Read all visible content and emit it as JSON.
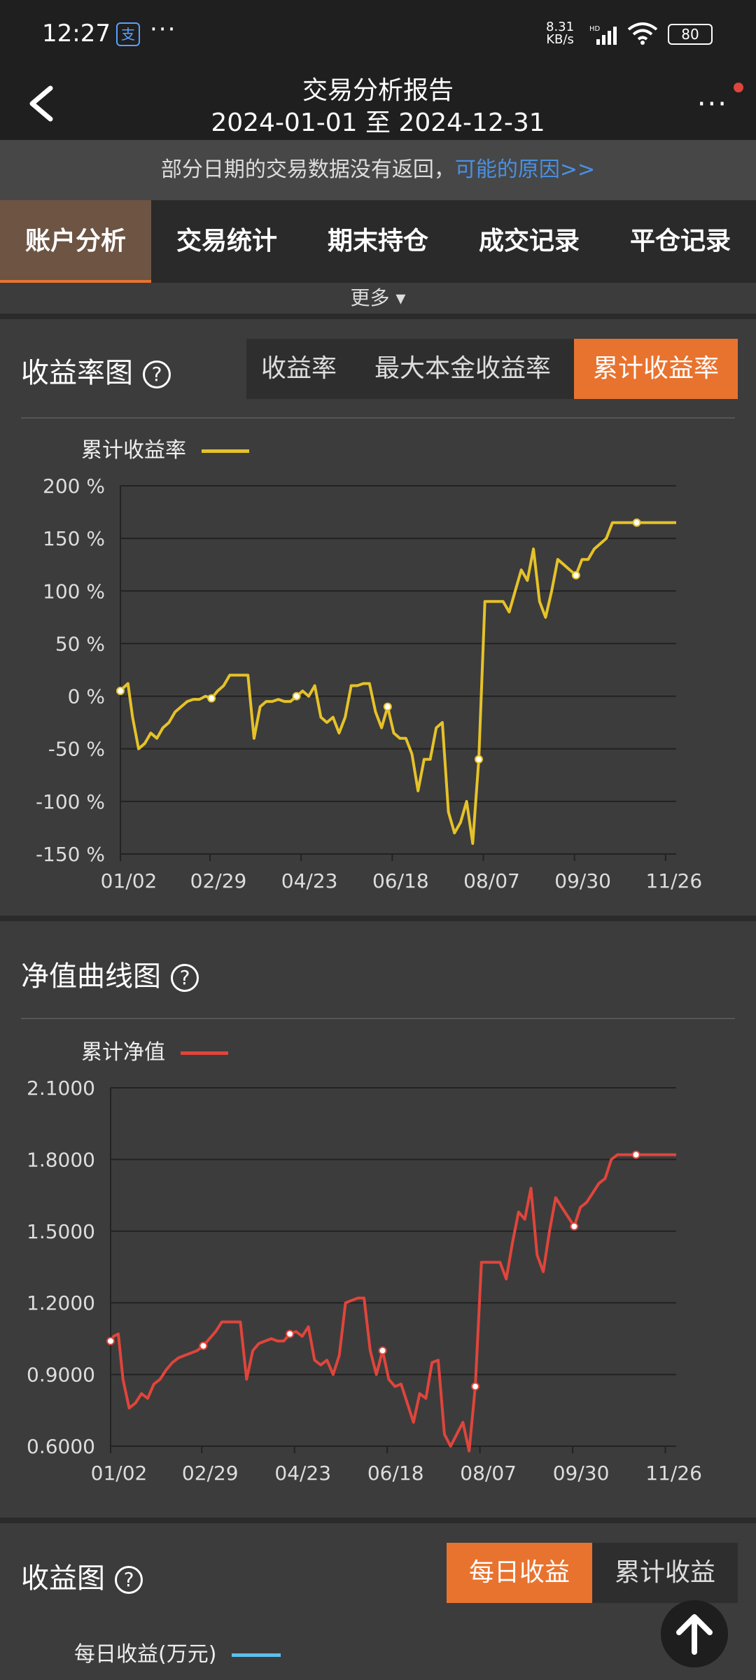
{
  "status": {
    "time": "12:27",
    "app_badge": "支",
    "dots": "···",
    "net_speed": "8.31",
    "net_unit": "KB/s",
    "hd": "HD",
    "battery": "80"
  },
  "header": {
    "title": "交易分析报告",
    "date_range": "2024-01-01 至 2024-12-31",
    "more": "···"
  },
  "notice": {
    "text": "部分日期的交易数据没有返回，",
    "link": "可能的原因>>"
  },
  "tabs": [
    "账户分析",
    "交易统计",
    "期末持仓",
    "成交记录",
    "平仓记录"
  ],
  "more_row": "更多 ▾",
  "return_section": {
    "title": "收益率图",
    "help": "?",
    "segments": [
      "收益率",
      "最大本金收益率",
      "累计收益率"
    ],
    "active_segment": 2
  },
  "nav_section": {
    "title": "净值曲线图",
    "help": "?"
  },
  "profit_section": {
    "title": "收益图",
    "help": "?",
    "segments": [
      "每日收益",
      "累计收益"
    ],
    "active_segment": 0,
    "legend": "每日收益(万元)",
    "legend_color": "#5bc0eb"
  },
  "colors": {
    "accent": "#e8732f",
    "yellow": "#e6c229",
    "red": "#e0453b",
    "link": "#4a90e2"
  },
  "chart_data": [
    {
      "type": "line",
      "legend": "累计收益率",
      "series": [
        {
          "name": "累计收益率",
          "color": "#e6c229",
          "x": [
            0,
            2,
            5,
            8,
            12,
            16,
            20,
            24,
            28,
            32,
            36,
            40,
            44,
            48,
            52,
            56,
            60,
            64,
            68,
            72,
            76,
            80,
            84,
            88,
            92,
            96,
            100,
            104,
            108,
            112,
            116,
            120,
            124,
            128,
            132,
            136,
            140,
            144,
            148,
            152,
            156,
            160,
            164,
            168,
            172,
            176,
            180,
            184,
            188,
            192,
            196,
            200,
            204,
            208,
            212,
            216,
            220,
            224,
            228,
            232,
            236,
            240,
            244,
            248,
            252,
            256,
            260,
            264,
            268,
            272,
            276,
            280,
            284,
            288,
            292,
            296,
            300,
            304,
            308,
            312,
            316,
            320,
            324,
            328,
            332,
            336,
            340,
            344,
            348,
            352,
            356,
            360,
            362,
            366
          ],
          "y": [
            5,
            8,
            12,
            -20,
            -50,
            -45,
            -35,
            -40,
            -30,
            -25,
            -15,
            -10,
            -5,
            -3,
            -3,
            0,
            -2,
            5,
            10,
            20,
            20,
            20,
            20,
            -40,
            -10,
            -5,
            -5,
            -3,
            -5,
            -5,
            0,
            5,
            0,
            10,
            -20,
            -25,
            -20,
            -35,
            -20,
            10,
            10,
            12,
            12,
            -15,
            -30,
            -10,
            -35,
            -40,
            -40,
            -55,
            -90,
            -60,
            -60,
            -30,
            -25,
            -110,
            -130,
            -120,
            -100,
            -140,
            -60,
            90,
            90,
            90,
            90,
            80,
            100,
            120,
            110,
            140,
            90,
            75,
            100,
            130,
            125,
            120,
            115,
            130,
            130,
            140,
            145,
            150,
            165,
            165,
            165,
            165,
            165,
            165,
            165,
            165,
            165,
            165,
            165,
            165
          ]
        }
      ],
      "ylim": [
        -150,
        200
      ],
      "yticks": [
        "200 %",
        "150 %",
        "100 %",
        "50 %",
        "0 %",
        "-50 %",
        "-100 %",
        "-150 %"
      ],
      "xticks": [
        "01/02",
        "02/29",
        "04/23",
        "06/18",
        "08/07",
        "09/30",
        "11/26"
      ],
      "grid": true
    },
    {
      "type": "line",
      "legend": "累计净值",
      "series": [
        {
          "name": "累计净值",
          "color": "#e0453b",
          "x": [
            0,
            2,
            5,
            8,
            12,
            16,
            20,
            24,
            28,
            32,
            36,
            40,
            44,
            48,
            52,
            56,
            60,
            64,
            68,
            72,
            76,
            80,
            84,
            88,
            92,
            96,
            100,
            104,
            108,
            112,
            116,
            120,
            124,
            128,
            132,
            136,
            140,
            144,
            148,
            152,
            156,
            160,
            164,
            168,
            172,
            176,
            180,
            184,
            188,
            192,
            196,
            200,
            204,
            208,
            212,
            216,
            220,
            224,
            228,
            232,
            236,
            240,
            244,
            248,
            252,
            256,
            260,
            264,
            268,
            272,
            276,
            280,
            284,
            288,
            292,
            296,
            300,
            304,
            308,
            312,
            316,
            320,
            324,
            328,
            332,
            336,
            340,
            344,
            348,
            352,
            356,
            360,
            362,
            366
          ],
          "y": [
            1.04,
            1.06,
            1.07,
            0.88,
            0.76,
            0.78,
            0.82,
            0.8,
            0.86,
            0.88,
            0.92,
            0.95,
            0.97,
            0.98,
            0.99,
            1.0,
            1.02,
            1.05,
            1.08,
            1.12,
            1.12,
            1.12,
            1.12,
            0.88,
            1.0,
            1.03,
            1.04,
            1.05,
            1.04,
            1.04,
            1.07,
            1.08,
            1.06,
            1.1,
            0.96,
            0.94,
            0.96,
            0.9,
            0.98,
            1.2,
            1.21,
            1.22,
            1.22,
            1.0,
            0.9,
            1.0,
            0.88,
            0.85,
            0.86,
            0.78,
            0.7,
            0.82,
            0.8,
            0.95,
            0.96,
            0.65,
            0.6,
            0.65,
            0.7,
            0.58,
            0.85,
            1.37,
            1.37,
            1.37,
            1.37,
            1.3,
            1.45,
            1.58,
            1.55,
            1.68,
            1.4,
            1.33,
            1.5,
            1.64,
            1.6,
            1.56,
            1.52,
            1.6,
            1.62,
            1.66,
            1.7,
            1.72,
            1.8,
            1.82,
            1.82,
            1.82,
            1.82,
            1.82,
            1.82,
            1.82,
            1.82,
            1.82,
            1.82,
            1.82
          ]
        }
      ],
      "ylim": [
        0.6,
        2.1
      ],
      "yticks": [
        "2.1000",
        "1.8000",
        "1.5000",
        "1.2000",
        "0.9000",
        "0.6000"
      ],
      "xticks": [
        "01/02",
        "02/29",
        "04/23",
        "06/18",
        "08/07",
        "09/30",
        "11/26"
      ],
      "grid": true
    }
  ]
}
